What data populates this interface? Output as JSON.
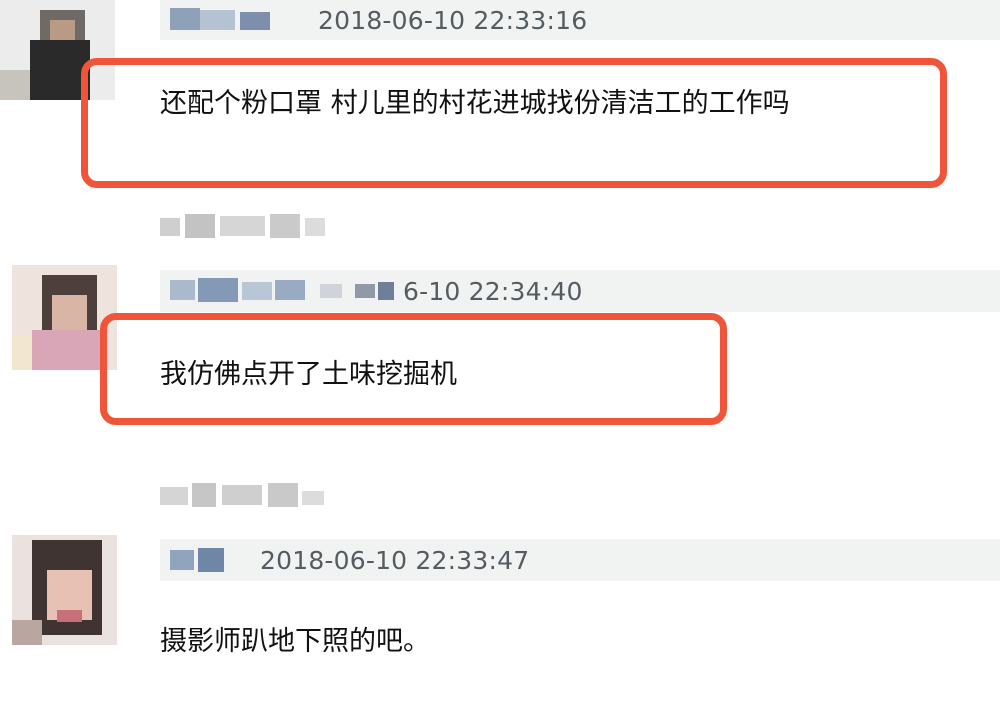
{
  "comments": [
    {
      "timestamp": "2018-06-10 22:33:16",
      "text": "还配个粉口罩 村儿里的村花进城找份清洁工的工作吗",
      "highlighted": true,
      "avatar": "avatar-man-blurred",
      "username": "blurred"
    },
    {
      "timestamp": "6-10 22:34:40",
      "text": "我仿佛点开了土味挖掘机",
      "highlighted": true,
      "avatar": "avatar-woman-blurred",
      "username": "blurred"
    },
    {
      "timestamp": "2018-06-10 22:33:47",
      "text": "摄影师趴地下照的吧。",
      "highlighted": false,
      "avatar": "avatar-girl-blurred",
      "username": "blurred"
    }
  ],
  "colors": {
    "highlight": "#f0553a",
    "header_bg": "#f1f3f3",
    "timestamp": "#555c61"
  }
}
